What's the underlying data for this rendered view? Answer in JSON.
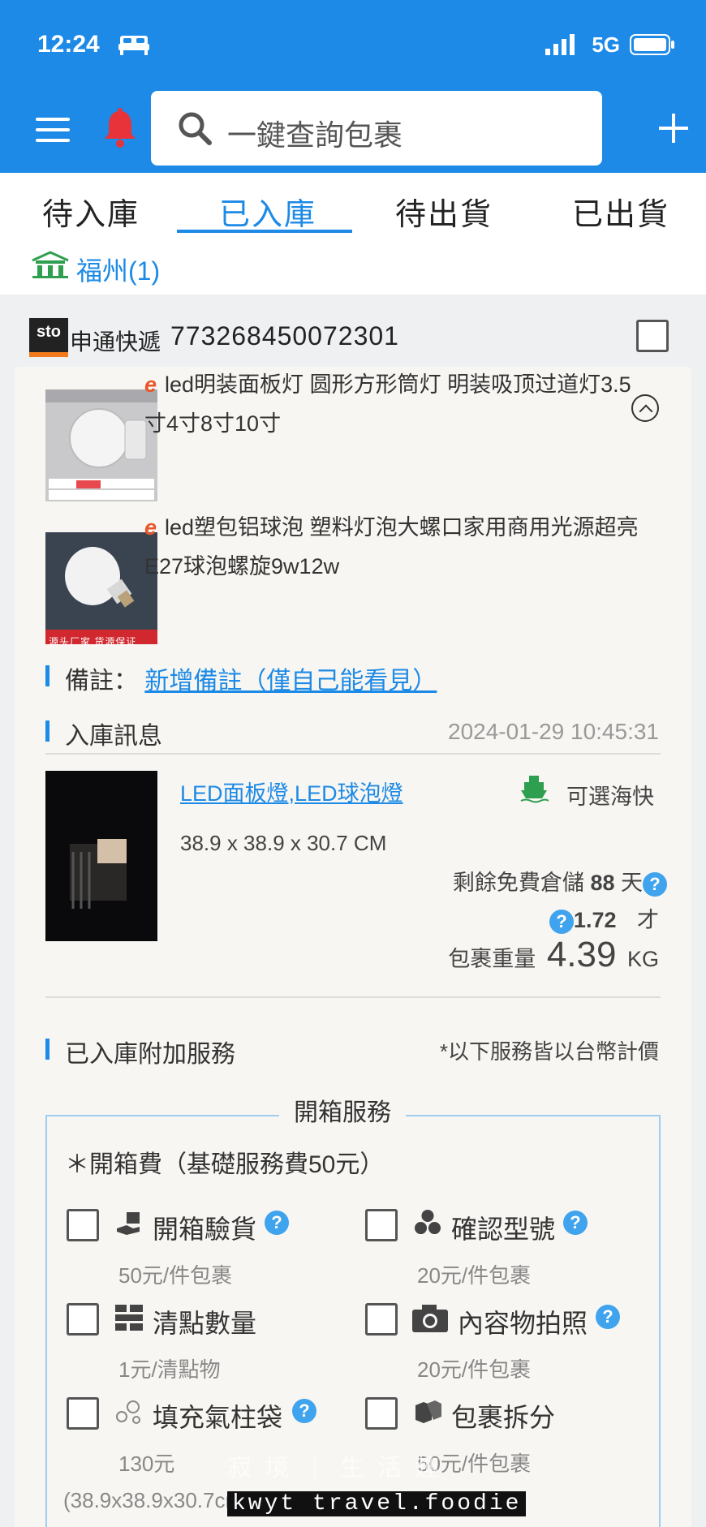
{
  "status_bar": {
    "time": "12:24",
    "network": "5G"
  },
  "header": {
    "search_placeholder": "一鍵查詢包裹"
  },
  "tabs": [
    "待入庫",
    "已入庫",
    "待出貨",
    "已出貨"
  ],
  "location": "福州(1)",
  "package": {
    "carrier": "申通快遞",
    "carrier_logo_text": "sto",
    "tracking_number": "773268450072301",
    "products": [
      {
        "title": "led明装面板灯 圆形方形筒灯 明装吸顶过道灯3.5寸4寸8寸10寸",
        "marketplace_mark": "e"
      },
      {
        "title": "led塑包铝球泡 塑料灯泡大螺口家用商用光源超亮E27球泡螺旋9w12w",
        "marketplace_mark": "e",
        "image_banner": "源头厂家 货源保证"
      }
    ],
    "note_label": "備註：",
    "note_link": "新增備註（僅自己能看見）",
    "inbound_label": "入庫訊息",
    "inbound_time": "2024-01-29 10:45:31",
    "item_names_1": "LED面板燈",
    "item_names_sep": ",",
    "item_names_2": "LED球泡燈",
    "shipping_option": "可選海快",
    "dimensions": "38.9 x 38.9 x 30.7 CM",
    "free_storage_prefix": "剩餘免費倉儲",
    "free_storage_days": "88",
    "free_storage_suffix": "天",
    "cbm_value": "1.72",
    "cbm_unit": "才",
    "weight_label": "包裹重量",
    "weight_value": "4.39",
    "weight_unit": "KG"
  },
  "services": {
    "section_label": "已入庫附加服務",
    "currency_note": "*以下服務皆以台幣計價",
    "box_title": "開箱服務",
    "opening_fee": "＊開箱費（基礎服務費50元）",
    "items": [
      {
        "label": "開箱驗貨",
        "price": "50元/件包裹",
        "help": true
      },
      {
        "label": "確認型號",
        "price": "20元/件包裹",
        "help": true
      },
      {
        "label": "清點數量",
        "price": "1元/清點物",
        "help": false
      },
      {
        "label": "內容物拍照",
        "price": "20元/件包裹",
        "help": true
      },
      {
        "label": "填充氣柱袋",
        "price": "130元",
        "help": true
      },
      {
        "label": "包裹拆分",
        "price": "50元/件包裹",
        "help": false
      }
    ],
    "dim_note": "(38.9x38.9x30.7cm)"
  },
  "help_mark": "?",
  "watermark": {
    "line1": "寂 境 ｜ 生 活 趣",
    "line2": "kwyt travel.foodie"
  },
  "colors": {
    "primary": "#1c8ae6",
    "bell": "#e8333a",
    "ship": "#2e9e4f"
  }
}
